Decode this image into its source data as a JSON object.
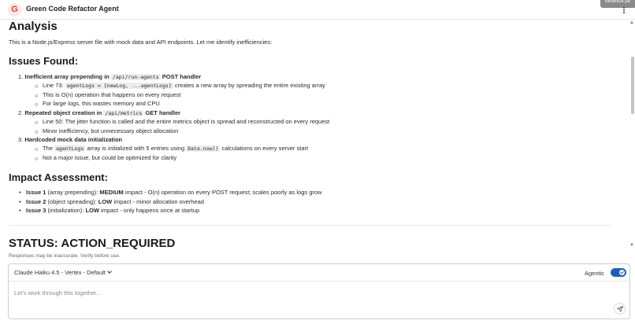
{
  "header": {
    "logo_letter": "G",
    "title": "Green Code Refactor Agent",
    "tooltip": "Minimize pa"
  },
  "content": {
    "analysis_heading": "Analysis",
    "intro": "This is a Node.js/Express server file with mock data and API endpoints. Let me identify inefficiencies:",
    "issues_heading": "Issues Found:",
    "issues": [
      {
        "num": "1.",
        "title_pre": "Inefficient array prepending in ",
        "title_code": "/api/run-agents",
        "title_post": " POST handler",
        "subs": [
          {
            "pre": "Line 73: ",
            "code": "agentLogs = [newLog, ...agentLogs]",
            "post": " creates a new array by spreading the entire existing array"
          },
          {
            "pre": "This is O(n) operation that happens on every request"
          },
          {
            "pre": "For large logs, this wastes memory and CPU"
          }
        ]
      },
      {
        "num": "2.",
        "title_pre": "Repeated object creation in ",
        "title_code": "/api/metrics",
        "title_post": " GET handler",
        "subs": [
          {
            "pre": "Line 50: The jitter function is called and the entire metrics object is spread and reconstructed on every request"
          },
          {
            "pre": "Minor inefficiency, but unnecessary object allocation"
          }
        ]
      },
      {
        "num": "3.",
        "title_pre": "Hardcoded mock data initialization",
        "subs": [
          {
            "pre": "The ",
            "code": "agentLogs",
            "mid": " array is initialized with 5 entries using ",
            "code2": "Date.now()",
            "post": " calculations on every server start"
          },
          {
            "pre": "Not a major issue, but could be optimized for clarity"
          }
        ]
      }
    ],
    "impact_heading": "Impact Assessment:",
    "impacts": [
      {
        "label": "Issue 1",
        "paren": " (array prepending): ",
        "level": "MEDIUM",
        "desc": " impact - O(n) operation on every POST request; scales poorly as logs grow"
      },
      {
        "label": "Issue 2",
        "paren": " (object spreading): ",
        "level": "LOW",
        "desc": " impact - minor allocation overhead"
      },
      {
        "label": "Issue 3",
        "paren": " (initialization): ",
        "level": "LOW",
        "desc": " impact - only happens once at startup"
      }
    ],
    "status_heading": "STATUS: ACTION_REQUIRED"
  },
  "footer": {
    "disclaimer": "Responses may be inaccurate. Verify before use.",
    "model_label": "Claude Haiku 4.5 - Vertex - Default",
    "agentic_label": "Agentic",
    "agentic_enabled": true,
    "placeholder": "Let's work through this together..."
  },
  "colors": {
    "accent": "#1e5fb3",
    "logo_bg": "#fde7e4",
    "logo_fg": "#d6453a"
  }
}
